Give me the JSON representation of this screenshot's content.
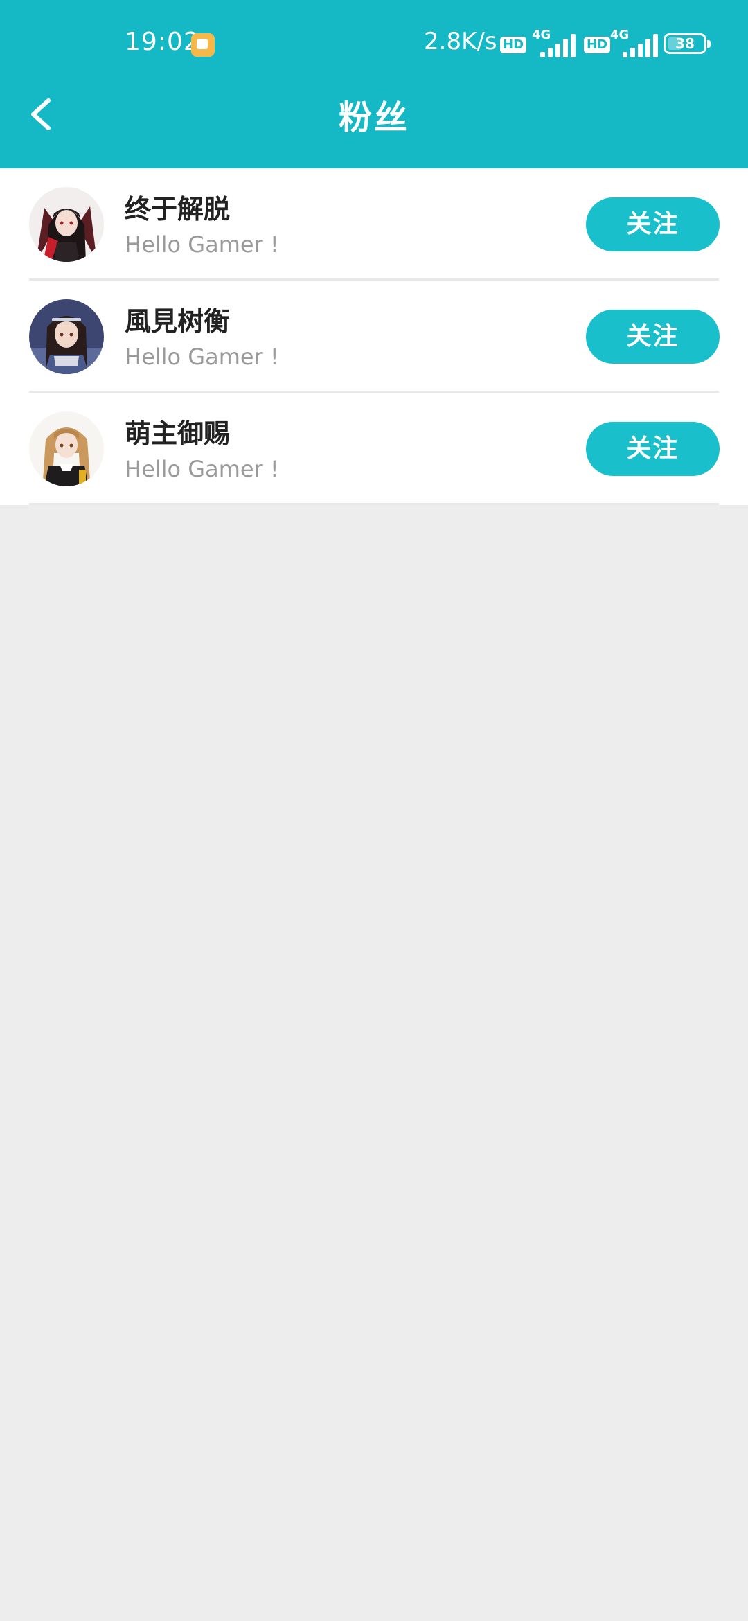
{
  "status_bar": {
    "time": "19:02",
    "speed": "2.8K/s",
    "hd_label": "HD",
    "network_label": "4G",
    "battery": "38"
  },
  "header": {
    "title": "粉丝"
  },
  "fans": [
    {
      "name": "终于解脱",
      "signature": "Hello Gamer !",
      "follow_label": "关注"
    },
    {
      "name": "風見树衡",
      "signature": "Hello Gamer !",
      "follow_label": "关注"
    },
    {
      "name": "萌主御赐",
      "signature": "Hello Gamer !",
      "follow_label": "关注"
    }
  ],
  "colors": {
    "primary": "#15b9c6",
    "button": "#19c0cb",
    "background": "#ededed"
  },
  "icons": {
    "back": "chevron-left-icon",
    "notification": "notification-icon",
    "signal": "signal-icon",
    "battery": "battery-icon"
  }
}
